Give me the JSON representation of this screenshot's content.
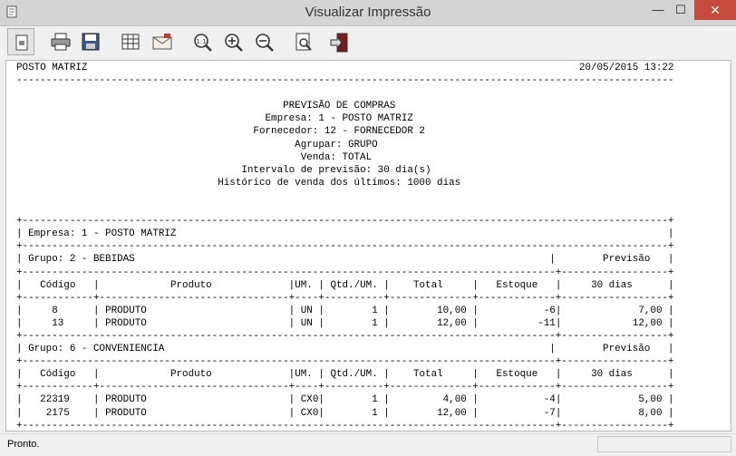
{
  "window": {
    "title": "Visualizar Impressão",
    "minimize": "—",
    "maximize": "☐",
    "close": "✕"
  },
  "toolbar": {
    "buttons": [
      "page-view",
      "print",
      "save",
      "export-spreadsheet",
      "email",
      "zoom-actual-size",
      "zoom-in",
      "zoom-out",
      "find",
      "exit"
    ]
  },
  "report": {
    "company": "POSTO MATRIZ",
    "datetime": "20/05/2015 13:22",
    "title": "PREVISÃO DE COMPRAS",
    "filters": [
      "Empresa: 1 - POSTO MATRIZ",
      "Fornecedor: 12 - FORNECEDOR 2",
      "Agrupar: GRUPO",
      "Venda: TOTAL",
      "Intervalo de previsão: 30 dia(s)",
      "Histórico de venda dos últimos: 1000 dias"
    ],
    "empresa_line": "Empresa: 1 - POSTO MATRIZ",
    "columns": {
      "codigo": "Código",
      "produto": "Produto",
      "um": "UM.",
      "qtd_um": "Qtd./UM.",
      "total": "Total",
      "estoque": "Estoque",
      "previsao": "30 dias"
    },
    "previsao_label": "Previsão",
    "groups": [
      {
        "label": "Grupo: 2 - BEBIDAS",
        "rows": [
          {
            "codigo": "8",
            "produto": "PRODUTO",
            "um": "UN",
            "qtd": "1",
            "total": "10,00",
            "estoque": "-6",
            "previsao": "7,00"
          },
          {
            "codigo": "13",
            "produto": "PRODUTO",
            "um": "UN",
            "qtd": "1",
            "total": "12,00",
            "estoque": "-11",
            "previsao": "12,00"
          }
        ]
      },
      {
        "label": "Grupo: 6 - CONVENIENCIA",
        "rows": [
          {
            "codigo": "22319",
            "produto": "PRODUTO",
            "um": "CX0",
            "qtd": "1",
            "total": "4,00",
            "estoque": "-4",
            "previsao": "5,00"
          },
          {
            "codigo": "2175",
            "produto": "PRODUTO",
            "um": "CX0",
            "qtd": "1",
            "total": "12,00",
            "estoque": "-7",
            "previsao": "8,00"
          }
        ]
      }
    ]
  },
  "status": {
    "text": "Pronto."
  }
}
